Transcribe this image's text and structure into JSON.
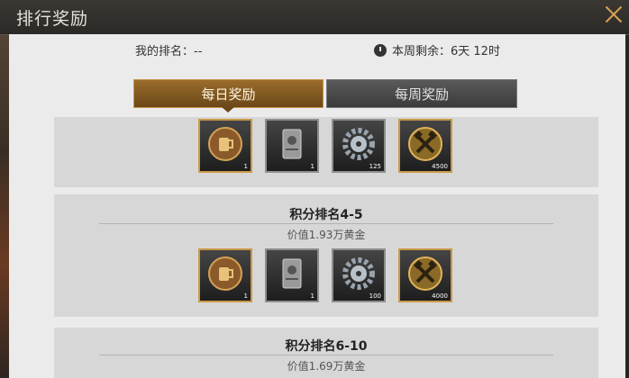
{
  "window": {
    "title": "排行奖励"
  },
  "header": {
    "my_rank": "我的排名：--",
    "week_remaining": "本周剩余：6天 12时"
  },
  "tabs": [
    {
      "label": "每日奖励",
      "active": true
    },
    {
      "label": "每周奖励",
      "active": false
    }
  ],
  "reward_groups": [
    {
      "title": "",
      "value": "",
      "items": [
        {
          "icon": "beer-mug-icon",
          "count": "1"
        },
        {
          "icon": "ticket-icon",
          "count": "1"
        },
        {
          "icon": "gear-icon",
          "count": "125"
        },
        {
          "icon": "crossed-hammers-icon",
          "count": "4500"
        }
      ]
    },
    {
      "title": "积分排名4-5",
      "value": "价值1.93万黄金",
      "items": [
        {
          "icon": "beer-mug-icon",
          "count": "1"
        },
        {
          "icon": "ticket-icon",
          "count": "1"
        },
        {
          "icon": "gear-icon",
          "count": "100"
        },
        {
          "icon": "crossed-hammers-icon",
          "count": "4000"
        }
      ]
    },
    {
      "title": "积分排名6-10",
      "value": "价值1.69万黄金",
      "items": []
    }
  ],
  "colors": {
    "gold_border": "#c99a48",
    "active_tab": "#8a5e24",
    "panel_bg": "#ebebeb",
    "group_bg": "#d7d7d7"
  }
}
